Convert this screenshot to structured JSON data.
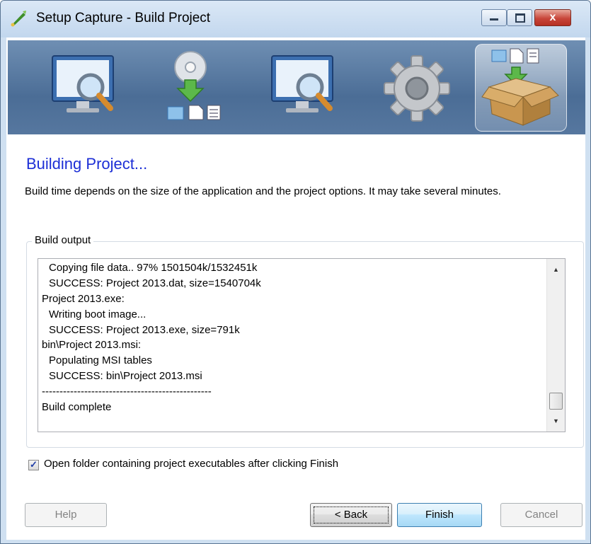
{
  "window": {
    "title": "Setup Capture - Build Project",
    "close_glyph": "x"
  },
  "wizard_steps": [
    {
      "icon": "monitor-magnifier-icon",
      "active": false
    },
    {
      "icon": "cd-install-icon",
      "active": false
    },
    {
      "icon": "monitor-magnifier-icon",
      "active": false
    },
    {
      "icon": "gear-icon",
      "active": false
    },
    {
      "icon": "package-box-icon",
      "active": true
    }
  ],
  "main": {
    "heading": "Building Project...",
    "description": "Build time depends on the size of the application and the project options. It may take several minutes."
  },
  "build_output": {
    "label": "Build output",
    "lines": [
      "Copying file data.. 97% 1501504k/1532451k",
      "SUCCESS: Project 2013.dat, size=1540704k",
      "Project 2013.exe:",
      "Writing boot image...",
      "SUCCESS: Project 2013.exe, size=791k",
      "bin\\Project 2013.msi:",
      "Populating MSI tables",
      "SUCCESS: bin\\Project 2013.msi",
      "------------------------------------------------",
      "Build complete"
    ]
  },
  "options": {
    "open_folder_label": "Open folder containing project executables after clicking Finish",
    "open_folder_checked": true
  },
  "buttons": {
    "help": "Help",
    "back": "< Back",
    "finish": "Finish",
    "cancel": "Cancel"
  },
  "colors": {
    "heading": "#1d2fd6",
    "banner": "#4b6d96",
    "titlebar": "#c2d7ee"
  }
}
